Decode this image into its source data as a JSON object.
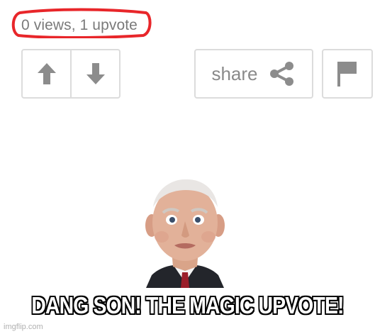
{
  "post_stats": {
    "text": "0 views, 1 upvote",
    "highlight_color": "#e8262a"
  },
  "vote": {
    "upvote_icon": "arrow-up-icon",
    "downvote_icon": "arrow-down-icon",
    "icon_color": "#8c8c8c"
  },
  "share": {
    "label": "share",
    "icon": "share-icon"
  },
  "flag": {
    "icon": "flag-icon"
  },
  "meme": {
    "caption": "DANG SON! THE MAGIC UPVOTE!",
    "photo_subject": "man-portrait"
  },
  "watermark": "imgflip.com"
}
